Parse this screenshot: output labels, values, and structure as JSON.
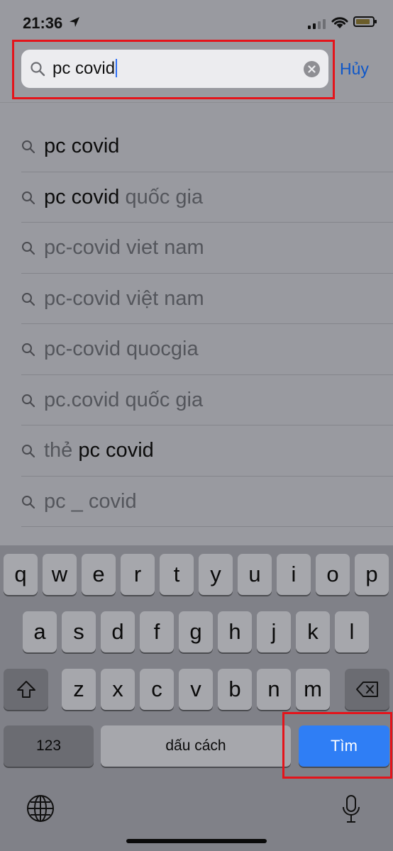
{
  "status_bar": {
    "time": "21:36"
  },
  "search": {
    "query": "pc covid",
    "cancel_label": "Hủy"
  },
  "suggestions": [
    {
      "bold": "pc covid",
      "rest": ""
    },
    {
      "bold": "pc covid",
      "rest": " quốc gia"
    },
    {
      "bold": "",
      "rest": "pc-covid viet nam"
    },
    {
      "bold": "",
      "rest": "pc-covid việt nam"
    },
    {
      "bold": "",
      "rest": "pc-covid quocgia"
    },
    {
      "bold": "",
      "rest": "pc.covid quốc gia"
    },
    {
      "prefix": "thẻ ",
      "bold": "pc covid",
      "rest": ""
    },
    {
      "bold": "",
      "rest": "pc _ covid"
    }
  ],
  "keyboard": {
    "row1": [
      "q",
      "w",
      "e",
      "r",
      "t",
      "y",
      "u",
      "i",
      "o",
      "p"
    ],
    "row2": [
      "a",
      "s",
      "d",
      "f",
      "g",
      "h",
      "j",
      "k",
      "l"
    ],
    "row3": [
      "z",
      "x",
      "c",
      "v",
      "b",
      "n",
      "m"
    ],
    "numbers_label": "123",
    "space_label": "dấu cách",
    "search_label": "Tìm"
  },
  "icons": [
    "location-arrow-icon",
    "signal-icon",
    "wifi-icon",
    "battery-icon",
    "search-icon",
    "clear-icon",
    "shift-icon",
    "backspace-icon",
    "globe-icon",
    "microphone-icon"
  ],
  "colors": {
    "accent": "#2f7ef5",
    "highlight": "#e4141b",
    "cancel": "#0e57c9"
  }
}
